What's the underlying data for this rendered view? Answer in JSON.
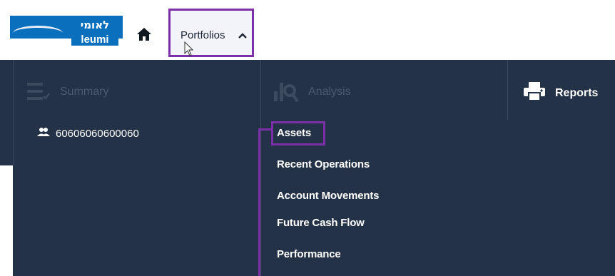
{
  "header": {
    "logo": {
      "hebrew": "לאומי",
      "english": "leumi"
    },
    "home_icon": "home-icon",
    "portfolios_label": "Portfolios",
    "portfolios_chevron": "chevron-up-icon"
  },
  "menu": {
    "summary": {
      "title": "Summary",
      "icon": "checklist-icon",
      "account": {
        "icon": "users-icon",
        "number": "60606060600060"
      }
    },
    "analysis": {
      "title": "Analysis",
      "icon": "chart-search-icon",
      "items": [
        {
          "label": "Assets"
        },
        {
          "label": "Recent Operations"
        },
        {
          "label": "Account Movements"
        },
        {
          "label": "Future Cash Flow"
        },
        {
          "label": "Performance"
        }
      ]
    },
    "reports": {
      "title": "Reports",
      "icon": "printer-icon"
    }
  },
  "colors": {
    "menu_bg": "#243247",
    "highlight": "#7b2fa8",
    "logo_blue": "#0a6fbd"
  }
}
